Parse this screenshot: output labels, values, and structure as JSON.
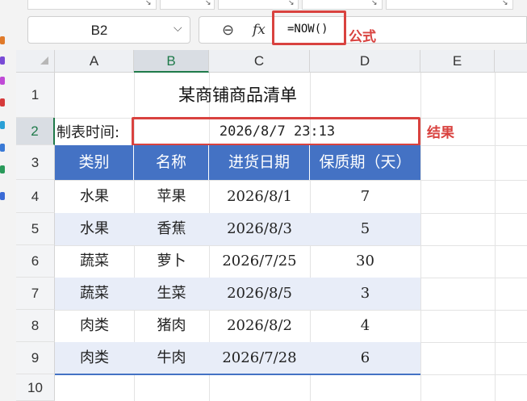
{
  "formula_bar": {
    "name_box": "B2",
    "formula": "=NOW()",
    "annotation": "公式"
  },
  "columns": [
    "A",
    "B",
    "C",
    "D",
    "E"
  ],
  "rows": [
    "1",
    "2",
    "3",
    "4",
    "5",
    "6",
    "7",
    "8",
    "9",
    "10"
  ],
  "sheet": {
    "title": "某商铺商品清单",
    "created_label": "制表时间:",
    "created_value": "2026/8/7  23:13",
    "result_annotation": "结果",
    "headers": [
      "类别",
      "名称",
      "进货日期",
      "保质期（天）"
    ],
    "data": [
      [
        "水果",
        "苹果",
        "2026/8/1",
        "7"
      ],
      [
        "水果",
        "香蕉",
        "2026/8/3",
        "5"
      ],
      [
        "蔬菜",
        "萝卜",
        "2026/7/25",
        "30"
      ],
      [
        "蔬菜",
        "生菜",
        "2026/8/5",
        "3"
      ],
      [
        "肉类",
        "猪肉",
        "2026/8/2",
        "4"
      ],
      [
        "肉类",
        "牛肉",
        "2026/7/28",
        "6"
      ]
    ]
  },
  "colors": {
    "header_fill": "#4472c4",
    "band_fill": "#e8edf8",
    "highlight": "#d9423f",
    "selection": "#1f7a4a"
  }
}
